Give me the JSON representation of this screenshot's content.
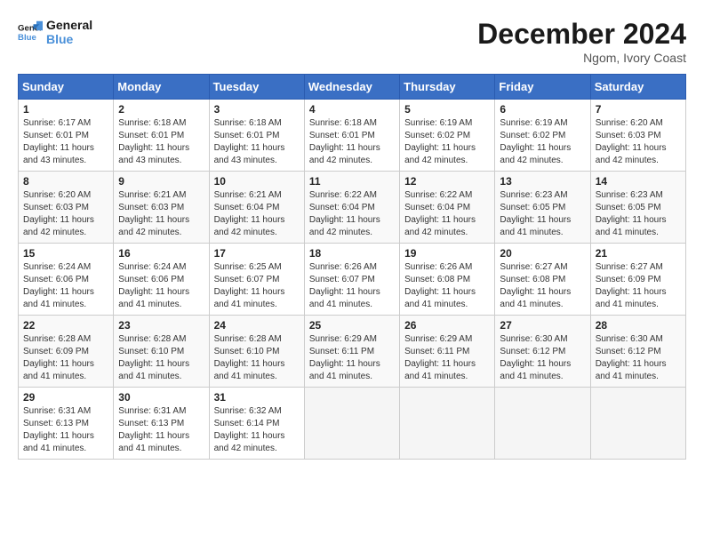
{
  "header": {
    "logo_line1": "General",
    "logo_line2": "Blue",
    "month_title": "December 2024",
    "location": "Ngom, Ivory Coast"
  },
  "days_of_week": [
    "Sunday",
    "Monday",
    "Tuesday",
    "Wednesday",
    "Thursday",
    "Friday",
    "Saturday"
  ],
  "weeks": [
    [
      {
        "day": "1",
        "info": "Sunrise: 6:17 AM\nSunset: 6:01 PM\nDaylight: 11 hours\nand 43 minutes."
      },
      {
        "day": "2",
        "info": "Sunrise: 6:18 AM\nSunset: 6:01 PM\nDaylight: 11 hours\nand 43 minutes."
      },
      {
        "day": "3",
        "info": "Sunrise: 6:18 AM\nSunset: 6:01 PM\nDaylight: 11 hours\nand 43 minutes."
      },
      {
        "day": "4",
        "info": "Sunrise: 6:18 AM\nSunset: 6:01 PM\nDaylight: 11 hours\nand 42 minutes."
      },
      {
        "day": "5",
        "info": "Sunrise: 6:19 AM\nSunset: 6:02 PM\nDaylight: 11 hours\nand 42 minutes."
      },
      {
        "day": "6",
        "info": "Sunrise: 6:19 AM\nSunset: 6:02 PM\nDaylight: 11 hours\nand 42 minutes."
      },
      {
        "day": "7",
        "info": "Sunrise: 6:20 AM\nSunset: 6:03 PM\nDaylight: 11 hours\nand 42 minutes."
      }
    ],
    [
      {
        "day": "8",
        "info": "Sunrise: 6:20 AM\nSunset: 6:03 PM\nDaylight: 11 hours\nand 42 minutes."
      },
      {
        "day": "9",
        "info": "Sunrise: 6:21 AM\nSunset: 6:03 PM\nDaylight: 11 hours\nand 42 minutes."
      },
      {
        "day": "10",
        "info": "Sunrise: 6:21 AM\nSunset: 6:04 PM\nDaylight: 11 hours\nand 42 minutes."
      },
      {
        "day": "11",
        "info": "Sunrise: 6:22 AM\nSunset: 6:04 PM\nDaylight: 11 hours\nand 42 minutes."
      },
      {
        "day": "12",
        "info": "Sunrise: 6:22 AM\nSunset: 6:04 PM\nDaylight: 11 hours\nand 42 minutes."
      },
      {
        "day": "13",
        "info": "Sunrise: 6:23 AM\nSunset: 6:05 PM\nDaylight: 11 hours\nand 41 minutes."
      },
      {
        "day": "14",
        "info": "Sunrise: 6:23 AM\nSunset: 6:05 PM\nDaylight: 11 hours\nand 41 minutes."
      }
    ],
    [
      {
        "day": "15",
        "info": "Sunrise: 6:24 AM\nSunset: 6:06 PM\nDaylight: 11 hours\nand 41 minutes."
      },
      {
        "day": "16",
        "info": "Sunrise: 6:24 AM\nSunset: 6:06 PM\nDaylight: 11 hours\nand 41 minutes."
      },
      {
        "day": "17",
        "info": "Sunrise: 6:25 AM\nSunset: 6:07 PM\nDaylight: 11 hours\nand 41 minutes."
      },
      {
        "day": "18",
        "info": "Sunrise: 6:26 AM\nSunset: 6:07 PM\nDaylight: 11 hours\nand 41 minutes."
      },
      {
        "day": "19",
        "info": "Sunrise: 6:26 AM\nSunset: 6:08 PM\nDaylight: 11 hours\nand 41 minutes."
      },
      {
        "day": "20",
        "info": "Sunrise: 6:27 AM\nSunset: 6:08 PM\nDaylight: 11 hours\nand 41 minutes."
      },
      {
        "day": "21",
        "info": "Sunrise: 6:27 AM\nSunset: 6:09 PM\nDaylight: 11 hours\nand 41 minutes."
      }
    ],
    [
      {
        "day": "22",
        "info": "Sunrise: 6:28 AM\nSunset: 6:09 PM\nDaylight: 11 hours\nand 41 minutes."
      },
      {
        "day": "23",
        "info": "Sunrise: 6:28 AM\nSunset: 6:10 PM\nDaylight: 11 hours\nand 41 minutes."
      },
      {
        "day": "24",
        "info": "Sunrise: 6:28 AM\nSunset: 6:10 PM\nDaylight: 11 hours\nand 41 minutes."
      },
      {
        "day": "25",
        "info": "Sunrise: 6:29 AM\nSunset: 6:11 PM\nDaylight: 11 hours\nand 41 minutes."
      },
      {
        "day": "26",
        "info": "Sunrise: 6:29 AM\nSunset: 6:11 PM\nDaylight: 11 hours\nand 41 minutes."
      },
      {
        "day": "27",
        "info": "Sunrise: 6:30 AM\nSunset: 6:12 PM\nDaylight: 11 hours\nand 41 minutes."
      },
      {
        "day": "28",
        "info": "Sunrise: 6:30 AM\nSunset: 6:12 PM\nDaylight: 11 hours\nand 41 minutes."
      }
    ],
    [
      {
        "day": "29",
        "info": "Sunrise: 6:31 AM\nSunset: 6:13 PM\nDaylight: 11 hours\nand 41 minutes."
      },
      {
        "day": "30",
        "info": "Sunrise: 6:31 AM\nSunset: 6:13 PM\nDaylight: 11 hours\nand 41 minutes."
      },
      {
        "day": "31",
        "info": "Sunrise: 6:32 AM\nSunset: 6:14 PM\nDaylight: 11 hours\nand 42 minutes."
      },
      null,
      null,
      null,
      null
    ]
  ]
}
